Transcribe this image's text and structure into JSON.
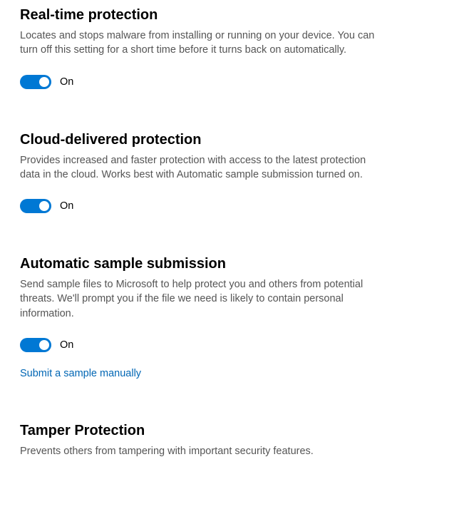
{
  "sections": {
    "realtime": {
      "title": "Real-time protection",
      "description": "Locates and stops malware from installing or running on your device. You can turn off this setting for a short time before it turns back on automatically.",
      "toggle_state": "On"
    },
    "cloud": {
      "title": "Cloud-delivered protection",
      "description": "Provides increased and faster protection with access to the latest protection data in the cloud. Works best with Automatic sample submission turned on.",
      "toggle_state": "On"
    },
    "sample": {
      "title": "Automatic sample submission",
      "description": "Send sample files to Microsoft to help protect you and others from potential threats. We'll prompt you if the file we need is likely to contain personal information.",
      "toggle_state": "On",
      "link_label": "Submit a sample manually"
    },
    "tamper": {
      "title": "Tamper Protection",
      "description": "Prevents others from tampering with important security features."
    }
  }
}
